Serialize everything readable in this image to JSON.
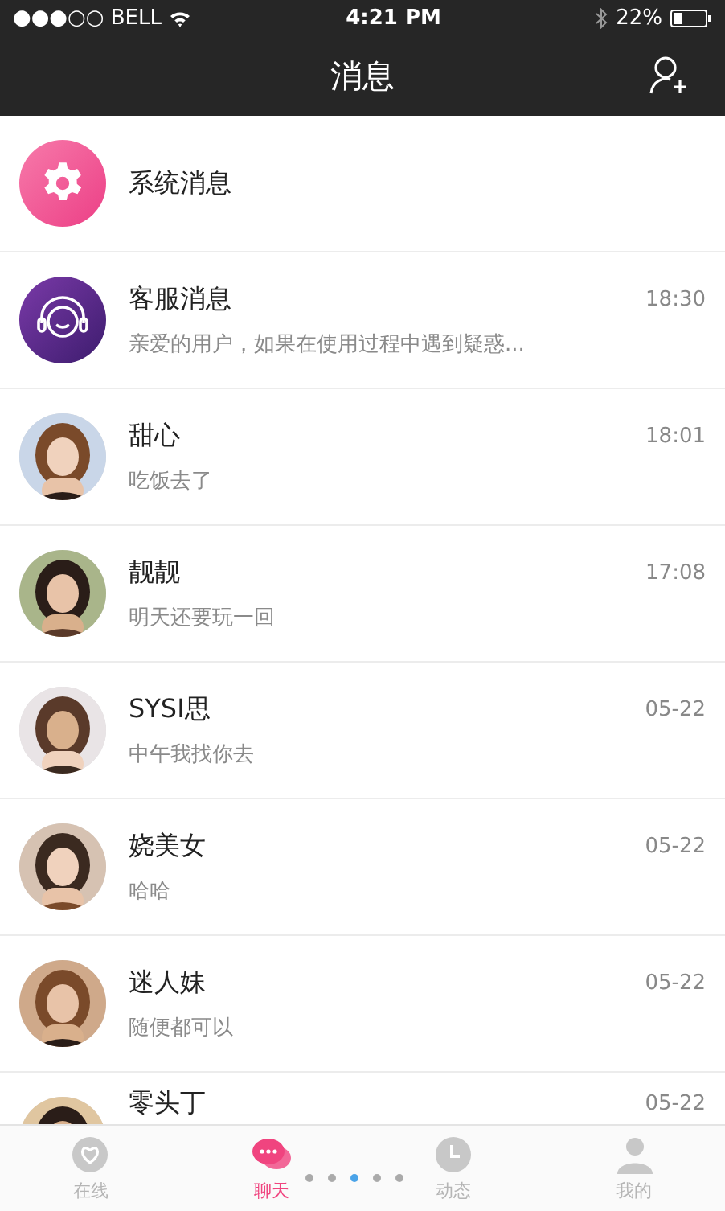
{
  "status_bar": {
    "carrier": "●●●○○ BELL",
    "time": "4:21 PM",
    "battery": "22%"
  },
  "nav_bar": {
    "title": "消息"
  },
  "conversations": [
    {
      "kind": "system",
      "name": "系统消息"
    },
    {
      "kind": "service",
      "name": "客服消息",
      "time": "18:30",
      "preview": "亲爱的用户，如果在使用过程中遇到疑惑..."
    },
    {
      "name": "甜心",
      "time": "18:01",
      "preview": "吃饭去了"
    },
    {
      "name": "靓靓",
      "time": "17:08",
      "preview": "明天还要玩一回"
    },
    {
      "name": "SYSI思",
      "time": "05-22",
      "preview": "中午我找你去"
    },
    {
      "name": "娆美女",
      "time": "05-22",
      "preview": "哈哈"
    },
    {
      "name": "迷人妹",
      "time": "05-22",
      "preview": "随便都可以"
    },
    {
      "name": "零头丁",
      "time": "05-22"
    }
  ],
  "tab_bar": {
    "tabs": [
      {
        "kind": "online",
        "label": "在线",
        "selected": false
      },
      {
        "kind": "chat",
        "label": "聊天",
        "selected": true
      },
      {
        "kind": "moments",
        "label": "动态",
        "selected": false
      },
      {
        "kind": "me",
        "label": "我的",
        "selected": false
      }
    ],
    "page_dots": [
      {
        "selected": false
      },
      {
        "selected": false
      },
      {
        "selected": true
      },
      {
        "selected": false
      },
      {
        "selected": false
      }
    ]
  }
}
